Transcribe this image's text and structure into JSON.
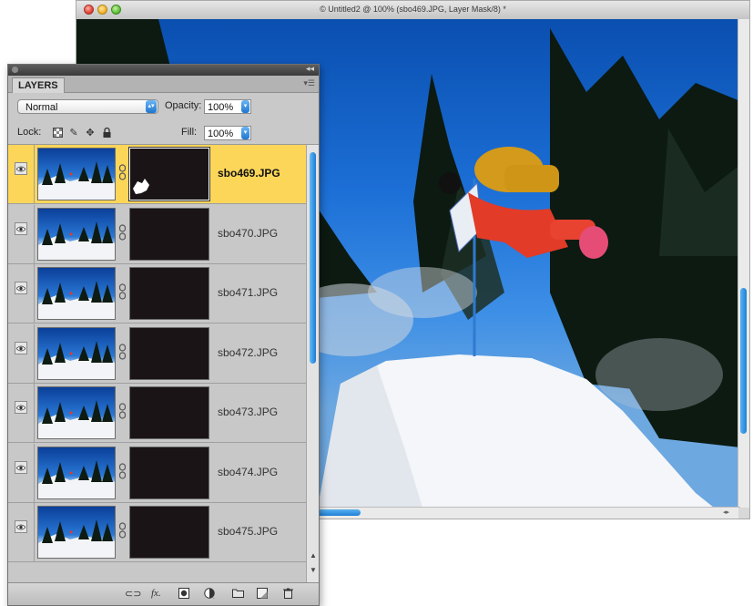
{
  "document": {
    "title": "© Untitled2 @ 100% (sbo469.JPG, Layer Mask/8) *"
  },
  "layers_panel": {
    "tab_label": "LAYERS",
    "blend_mode": "Normal",
    "opacity_label": "Opacity:",
    "opacity_value": "100%",
    "lock_label": "Lock:",
    "fill_label": "Fill:",
    "fill_value": "100%",
    "layers": [
      {
        "name": "sbo469.JPG",
        "selected": true,
        "visible": true
      },
      {
        "name": "sbo470.JPG",
        "selected": false,
        "visible": true
      },
      {
        "name": "sbo471.JPG",
        "selected": false,
        "visible": true
      },
      {
        "name": "sbo472.JPG",
        "selected": false,
        "visible": true
      },
      {
        "name": "sbo473.JPG",
        "selected": false,
        "visible": true
      },
      {
        "name": "sbo474.JPG",
        "selected": false,
        "visible": true
      },
      {
        "name": "sbo475.JPG",
        "selected": false,
        "visible": true
      }
    ],
    "footer_icons": [
      "link-layers-icon",
      "layer-style-icon",
      "add-mask-icon",
      "adjustment-layer-icon",
      "new-group-icon",
      "new-layer-icon",
      "delete-layer-icon"
    ]
  },
  "colors": {
    "selection": "#fcd659",
    "scroll_thumb": "#1e7fd6"
  }
}
